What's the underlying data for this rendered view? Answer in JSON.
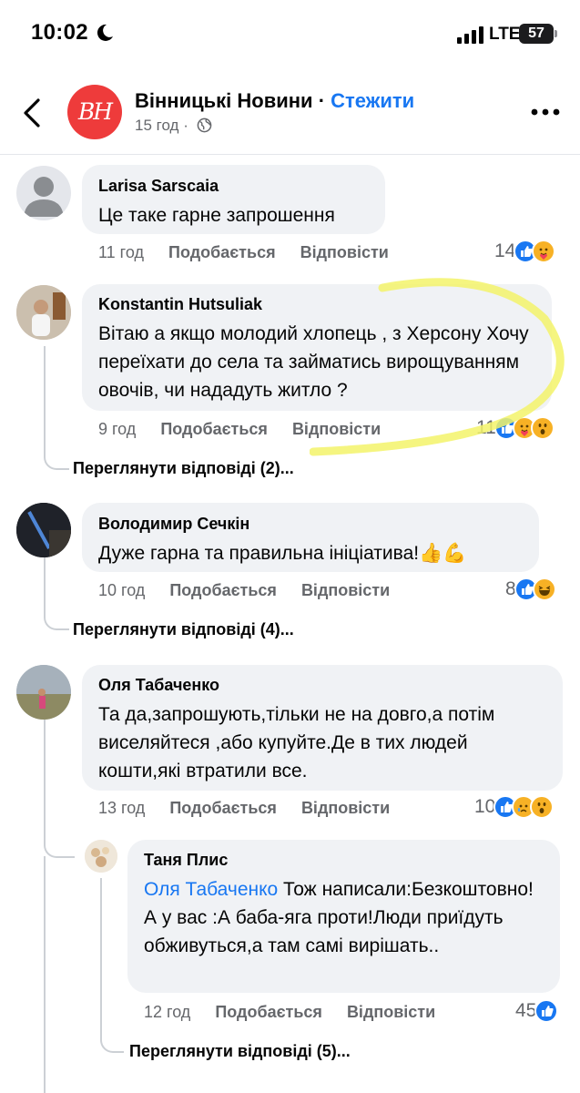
{
  "status_bar": {
    "time": "10:02",
    "network": "LTE",
    "battery": "57"
  },
  "header": {
    "page_avatar_text": "BH",
    "page_name": "Вінницькі Новини",
    "separator": " · ",
    "follow_label": "Стежити",
    "post_time": "15 год"
  },
  "actions": {
    "like": "Подобається",
    "reply": "Відповісти"
  },
  "comments": [
    {
      "author": "Larisa  Sarscaia",
      "text": "Це таке гарне запрошення",
      "time": "11 год",
      "reaction_count": "14",
      "reactions": [
        "like-icon",
        "care-icon"
      ]
    },
    {
      "author": "Konstantin Hutsuliak",
      "text": "Вітаю а якщо молодий хлопець , з Херсону Хочу переїхати до села та займатись вирощуванням овочів, чи нададуть житло ?",
      "time": "9 год",
      "reaction_count": "11",
      "reactions": [
        "like-icon",
        "care-icon",
        "wow-icon"
      ],
      "view_replies": "Переглянути відповіді (2)..."
    },
    {
      "author": "Володимир Сечкін",
      "text": "Дуже гарна та правильна ініціатива!",
      "emoji": "👍💪",
      "time": "10 год",
      "reaction_count": "8",
      "reactions": [
        "like-icon",
        "haha-icon"
      ],
      "view_replies": "Переглянути відповіді (4)..."
    },
    {
      "author": "Оля Табаченко",
      "text": "Та да,запрошують,тільки не на довго,а потім виселяйтеся ,або купуйте.Де в тих людей кошти,які втратили все.",
      "time": "13 год",
      "reaction_count": "10",
      "reactions": [
        "like-icon",
        "sad-icon",
        "wow-icon"
      ]
    }
  ],
  "reply": {
    "author": "Таня Плис",
    "mention": "Оля Табаченко",
    "text": " Тож написали:Безкоштовно!А у вас :А баба-яга проти!Люди приїдуть обживуться,а там самі вирішать..",
    "time": "12 год",
    "reaction_count": "45",
    "reactions": [
      "like-icon"
    ],
    "view_replies": "Переглянути відповіді (5)..."
  },
  "colors": {
    "accent": "#1877f2",
    "bubble": "#f0f2f5",
    "meta": "#65676b",
    "brand_avatar": "#ee3b3b",
    "highlight": "#f3f36a"
  }
}
